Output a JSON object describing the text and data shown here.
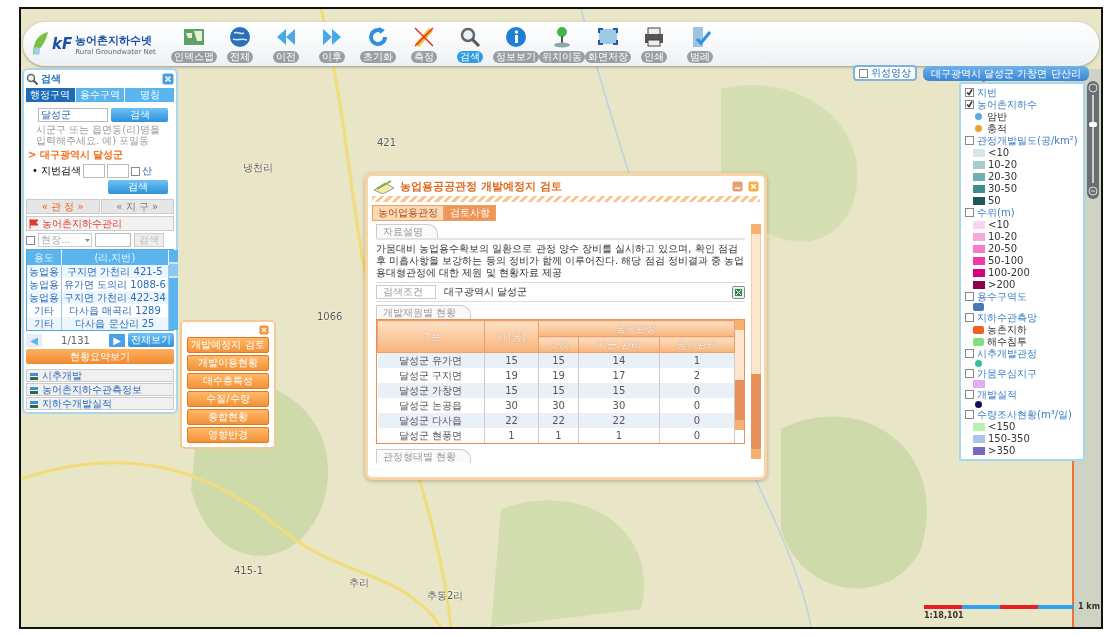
{
  "toolbar": {
    "logo": {
      "mark": "kF",
      "title": "농어촌지하수넷",
      "subtitle": "Rural Groundwater Net"
    },
    "buttons": [
      {
        "label": "인덱스맵",
        "selected": false
      },
      {
        "label": "전체",
        "selected": false
      },
      {
        "label": "이전",
        "selected": false
      },
      {
        "label": "이후",
        "selected": false
      },
      {
        "label": "초기화",
        "selected": false
      },
      {
        "label": "측정",
        "selected": false
      },
      {
        "label": "검색",
        "selected": true
      },
      {
        "label": "정보보기",
        "selected": false
      },
      {
        "label": "위치이동",
        "selected": false
      },
      {
        "label": "화면저장",
        "selected": false
      },
      {
        "label": "인쇄",
        "selected": false
      },
      {
        "label": "범례",
        "selected": false
      }
    ]
  },
  "map": {
    "labels": [
      "421",
      "냉천리",
      "1066",
      "415-1",
      "추리",
      "추동2리"
    ]
  },
  "search_panel": {
    "title": "검색",
    "tabs": [
      {
        "label": "행정구역",
        "selected": true
      },
      {
        "label": "용수구역",
        "selected": false
      },
      {
        "label": "명칭",
        "selected": false
      }
    ],
    "query": "달성군",
    "search_button": "검색",
    "hint": "시군구 또는 읍면동(리)명을 입력해주세요. 예) 포일동",
    "result": "> 대구광역시 달성군",
    "lot_label": "• 지번검색",
    "mountain_label": "산",
    "mountain_checked": false,
    "lot_button": "검색",
    "section_tabs": [
      {
        "label": "« 관 정 »",
        "selected": true
      },
      {
        "label": "« 지 구 »",
        "selected": false
      }
    ],
    "group_title": "농어촌지하수관리",
    "filter": {
      "checked": false,
      "select": "현장...",
      "button": "검색"
    },
    "columns": [
      "용도",
      "(리,지번)"
    ],
    "rows": [
      [
        "농업용",
        "구지면 가천리 421-5"
      ],
      [
        "농업용",
        "유가면 도의리 1088-6"
      ],
      [
        "농업용",
        "구지면 가천리 422-34"
      ],
      [
        "기타",
        "다사읍 매곡리 1289"
      ],
      [
        "기타",
        "다사읍 문산리 25"
      ]
    ],
    "pager": {
      "prev": "◀",
      "page": "1/131",
      "next": "▶",
      "all": "전체보기"
    },
    "summary_button": "현황요약보기",
    "bottom_items": [
      "시추개발",
      "농어촌지하수관측정보",
      "지하수개발실적"
    ]
  },
  "tool_menu": {
    "buttons": [
      "개발예정지 검토",
      "개발이용현황",
      "대수층특성",
      "수질/수량",
      "종합현황",
      "영향반경"
    ]
  },
  "dialog": {
    "title": "농업용공공관정 개발예정지 검토",
    "tabs": [
      {
        "label": "농어업용관정",
        "selected": false
      },
      {
        "label": "검토사항",
        "selected": true
      }
    ],
    "description_label": "자료설명",
    "description": "가뭄대비 농업용수확보의 일환으로 관정 양수 장비를 실시하고 있으며, 확인 점검 후 미흡사항을 보강하는 등의 정비가 함께 이루어진다. 해당 점검 정비결과 중 농업용대형관정에 대한 제원 및 현황자료 제공",
    "condition_label": "검색조건",
    "condition": "대구광역시 달성군",
    "table_title": "개발재원별 현황",
    "columns": {
      "region": "구분",
      "total": "계(공)",
      "group": "공공관정",
      "sub": [
        "소계",
        "시군 관리",
        "공사관리"
      ]
    },
    "rows": [
      [
        "달성군 유가면",
        "15",
        "15",
        "14",
        "1"
      ],
      [
        "달성군 구지면",
        "19",
        "19",
        "17",
        "2"
      ],
      [
        "달성군 가창면",
        "15",
        "15",
        "15",
        "0"
      ],
      [
        "달성군 논공읍",
        "30",
        "30",
        "30",
        "0"
      ],
      [
        "달성군 다사읍",
        "22",
        "22",
        "22",
        "0"
      ],
      [
        "달성군 현풍면",
        "1",
        "1",
        "1",
        "0"
      ]
    ],
    "next_section": "관정형태별 현황"
  },
  "satellite": {
    "label": "위성영상",
    "checked": false
  },
  "location": "대구광역시 달성군 가창면 단산리",
  "legend": {
    "layers": [
      {
        "label": "지번",
        "checked": true
      },
      {
        "label": "농어촌지하수",
        "checked": true,
        "entries": [
          {
            "kind": "dot",
            "label": "암반",
            "color": "#5aa8e0"
          },
          {
            "kind": "dot",
            "label": "충적",
            "color": "#f0a030"
          }
        ]
      },
      {
        "label": "관정개발밀도(공/km²)",
        "checked": false,
        "entries": [
          {
            "kind": "swatch",
            "label": "<10",
            "color": "#d6e6e6"
          },
          {
            "kind": "swatch",
            "label": "10-20",
            "color": "#a9cccc"
          },
          {
            "kind": "swatch",
            "label": "20-30",
            "color": "#6fb0b3"
          },
          {
            "kind": "swatch",
            "label": "30-50",
            "color": "#3f8c8f"
          },
          {
            "kind": "swatch",
            "label": "50",
            "color": "#1f5658"
          }
        ]
      },
      {
        "label": "수위(m)",
        "checked": false,
        "entries": [
          {
            "kind": "swatch",
            "label": "<10",
            "color": "#fcd4f0"
          },
          {
            "kind": "swatch",
            "label": "10-20",
            "color": "#f9a8dc"
          },
          {
            "kind": "swatch",
            "label": "20-50",
            "color": "#f57ac8"
          },
          {
            "kind": "swatch",
            "label": "50-100",
            "color": "#f03aa8"
          },
          {
            "kind": "swatch",
            "label": "100-200",
            "color": "#d4007f"
          },
          {
            "kind": "swatch",
            "label": ">200",
            "color": "#8c0050"
          }
        ]
      },
      {
        "label": "용수구역도",
        "checked": false,
        "entries": [
          {
            "kind": "marker",
            "color": "#4a78b8"
          }
        ]
      },
      {
        "label": "지하수관측망",
        "checked": false,
        "entries": [
          {
            "kind": "marker",
            "label": "농촌지하",
            "color": "#f06020"
          },
          {
            "kind": "marker",
            "label": "해수침투",
            "color": "#80e080"
          }
        ]
      },
      {
        "label": "시추개발관정",
        "checked": false,
        "entries": [
          {
            "kind": "dot",
            "color": "#30c0a0"
          }
        ]
      },
      {
        "label": "가뭄우심지구",
        "checked": false,
        "entries": [
          {
            "kind": "swatch",
            "color": "#e0b0f0"
          }
        ]
      },
      {
        "label": "개발실적",
        "checked": false,
        "entries": [
          {
            "kind": "dot",
            "color": "#101050"
          }
        ]
      },
      {
        "label": "수량조사현황(m³/일)",
        "checked": false,
        "entries": [
          {
            "kind": "swatch",
            "label": "<150",
            "color": "#b9f0b0"
          },
          {
            "kind": "swatch",
            "label": "150-350",
            "color": "#aac4ee"
          },
          {
            "kind": "swatch",
            "label": ">350",
            "color": "#7868c0"
          }
        ]
      }
    ]
  },
  "zoom_slider": {
    "level": 0.68
  },
  "scale": {
    "distance": "1 km",
    "ratio": "1:18,101"
  }
}
